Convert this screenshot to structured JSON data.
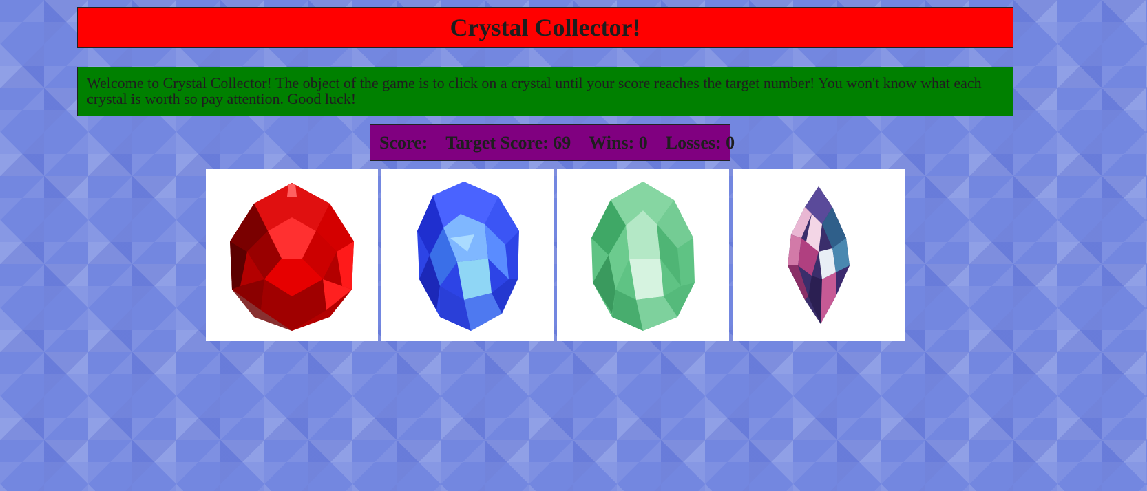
{
  "title": "Crystal Collector!",
  "intro": "Welcome to Crystal Collector! The object of the game is to click on a crystal until your score reaches the target number! You won't know what each crystal is worth so pay attention. Good luck!",
  "scoreboard": {
    "score_label": "Score:",
    "score_value": "",
    "target_label": "Target Score:",
    "target_value": "69",
    "wins_label": "Wins:",
    "wins_value": "0",
    "losses_label": "Losses:",
    "losses_value": "0"
  },
  "colors": {
    "title_bg": "#ff0000",
    "intro_bg": "#008000",
    "score_bg": "#800080",
    "page_bg": "#7387e0"
  },
  "crystals": [
    {
      "color": "red",
      "icon": "red-crystal-icon"
    },
    {
      "color": "blue",
      "icon": "blue-crystal-icon"
    },
    {
      "color": "green",
      "icon": "green-crystal-icon"
    },
    {
      "color": "pink-blue",
      "icon": "pink-crystal-icon"
    }
  ]
}
